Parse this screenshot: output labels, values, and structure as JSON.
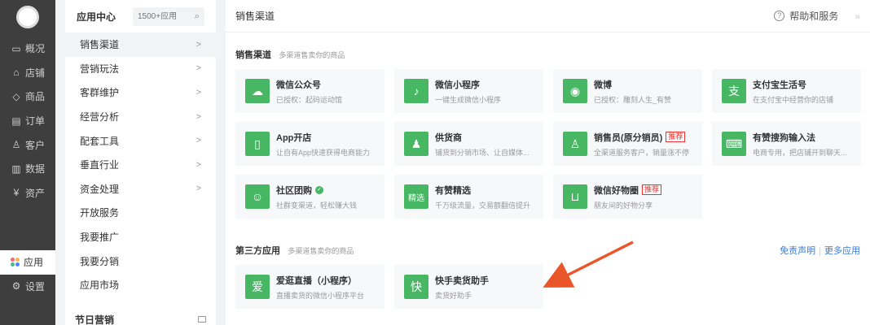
{
  "nav": {
    "items": [
      {
        "icon": "overview-icon",
        "glyph": "▭",
        "label": "概况"
      },
      {
        "icon": "shop-icon",
        "glyph": "⌂",
        "label": "店铺"
      },
      {
        "icon": "tag-icon",
        "glyph": "◇",
        "label": "商品"
      },
      {
        "icon": "order-icon",
        "glyph": "▤",
        "label": "订单"
      },
      {
        "icon": "customer-icon",
        "glyph": "♙",
        "label": "客户"
      },
      {
        "icon": "data-icon",
        "glyph": "▥",
        "label": "数据"
      },
      {
        "icon": "asset-icon",
        "glyph": "¥",
        "label": "资产"
      }
    ],
    "apps_label": "应用",
    "settings_label": "设置"
  },
  "sidebar": {
    "title": "应用中心",
    "search_placeholder": "1500+应用",
    "items": [
      {
        "label": "销售渠道",
        "arrow": ">"
      },
      {
        "label": "营销玩法",
        "arrow": ">"
      },
      {
        "label": "客群维护",
        "arrow": ">"
      },
      {
        "label": "经营分析",
        "arrow": ">"
      },
      {
        "label": "配套工具",
        "arrow": ">"
      },
      {
        "label": "垂直行业",
        "arrow": ">"
      },
      {
        "label": "资金处理",
        "arrow": ">"
      },
      {
        "label": "开放服务",
        "arrow": ""
      },
      {
        "label": "我要推广",
        "arrow": ""
      },
      {
        "label": "我要分销",
        "arrow": ""
      },
      {
        "label": "应用市场",
        "arrow": ""
      }
    ],
    "section2_title": "节日营销"
  },
  "header": {
    "title": "销售渠道",
    "help_label": "帮助和服务",
    "more_glyph": "»"
  },
  "sales": {
    "title": "销售渠道",
    "subtitle": "多渠道售卖你的商品",
    "cards": [
      {
        "name": "微信公众号",
        "desc": "已授权：起码运动馆",
        "glyph": "☁",
        "icon": "wechat-icon",
        "badge": ""
      },
      {
        "name": "微信小程序",
        "desc": "一键生成微信小程序",
        "glyph": "♪",
        "icon": "mini-program-icon",
        "badge": ""
      },
      {
        "name": "微博",
        "desc": "已授权：雕刻人生_有赞",
        "glyph": "◉",
        "icon": "weibo-icon",
        "badge": ""
      },
      {
        "name": "支付宝生活号",
        "desc": "在支付宝中经营你的店铺",
        "glyph": "支",
        "icon": "alipay-icon",
        "badge": ""
      },
      {
        "name": "App开店",
        "desc": "让自有App快速获得电商能力",
        "glyph": "▯",
        "icon": "app-icon",
        "badge": ""
      },
      {
        "name": "供货商",
        "desc": "铺货到分销市场、让自媒体...",
        "glyph": "♟",
        "icon": "supplier-icon",
        "badge": ""
      },
      {
        "name": "销售员(原分销员)",
        "desc": "全渠道服务客户，销量涨不停",
        "glyph": "♙",
        "icon": "salesman-icon",
        "badge": "推荐"
      },
      {
        "name": "有赞搜狗输入法",
        "desc": "电商专用，把店铺开到聊天...",
        "glyph": "⌨",
        "icon": "keyboard-icon",
        "badge": ""
      },
      {
        "name": "社区团购",
        "desc": "社群变渠道，轻松赚大钱",
        "glyph": "☺",
        "icon": "group-buy-icon",
        "badge": "",
        "verified": "✓"
      },
      {
        "name": "有赞精选",
        "desc": "千万级流量，交易额翻倍提升",
        "glyph": "精选",
        "icon": "selection-icon",
        "badge": ""
      },
      {
        "name": "微信好物圈",
        "desc": "朋友间的好物分享",
        "glyph": "⊔",
        "icon": "cart-icon",
        "badge": "推荐"
      }
    ]
  },
  "third": {
    "title": "第三方应用",
    "subtitle": "多渠道售卖你的商品",
    "disclaimer": "免责声明",
    "more": "更多应用",
    "cards": [
      {
        "name": "爱逛直播（小程序）",
        "desc": "直播卖货的微信小程序平台",
        "glyph": "爱",
        "icon": "aiguang-icon"
      },
      {
        "name": "快手卖货助手",
        "desc": "卖货好助手",
        "glyph": "快",
        "icon": "kuaishou-icon"
      }
    ]
  },
  "colors": {
    "accent": "#47b764",
    "badge": "#e33333",
    "link": "#3a7bd5",
    "arrow": "#e8562a"
  }
}
